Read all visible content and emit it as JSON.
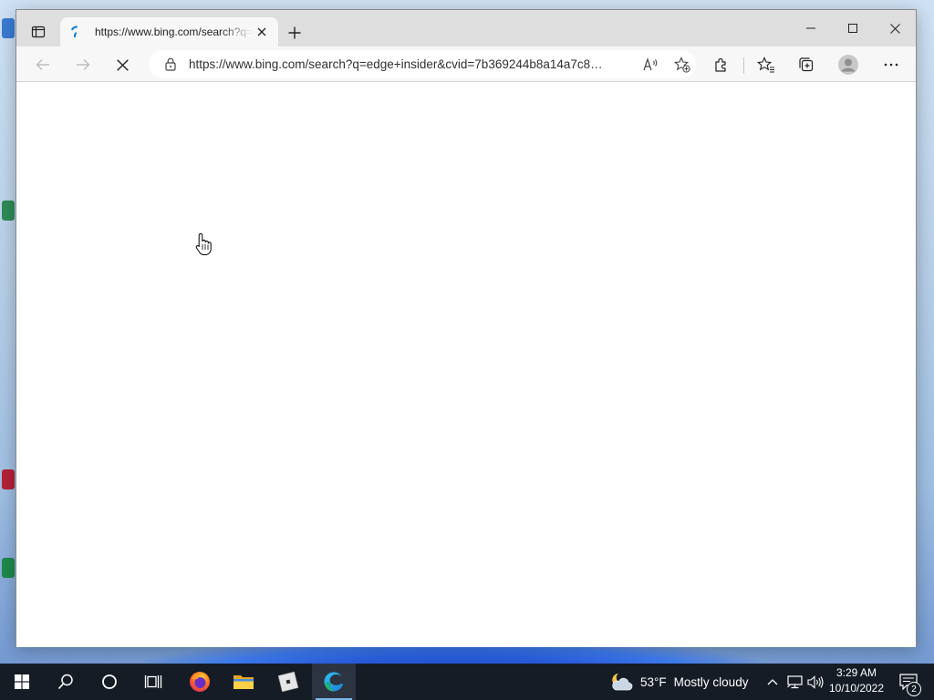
{
  "browser": {
    "tab": {
      "title": "https://www.bing.com/search?q=edge+insider",
      "close_icon": "close-icon",
      "favicon": "loading-spinner-icon"
    },
    "new_tab_icon": "plus-icon",
    "window_controls": [
      "minimize-icon",
      "maximize-icon",
      "close-icon"
    ],
    "toolbar": {
      "url": "https://www.bing.com/search?q=edge+insider&cvid=7b369244b8a14a7c8…",
      "back_icon": "arrow-left-icon",
      "forward_icon": "arrow-right-icon",
      "stop_icon": "stop-loading-icon",
      "read_aloud_icon": "read-aloud-icon",
      "add_favorite_icon": "star-add-icon",
      "extensions_icon": "puzzle-icon",
      "favorites_icon": "favorites-icon",
      "collections_icon": "collections-icon",
      "profile_icon": "profile-icon",
      "more_icon": "ellipsis-icon"
    }
  },
  "taskbar": {
    "apps": [
      "windows-start-icon",
      "search-icon",
      "cortana-icon",
      "task-view-icon",
      "firefox-icon",
      "file-explorer-icon",
      "roblox-icon",
      "edge-icon"
    ],
    "weather": {
      "icon": "partly-cloudy-night-icon",
      "temperature": "53°F",
      "condition": "Mostly cloudy"
    },
    "tray_icons": [
      "chevron-up-icon",
      "network-icon",
      "volume-icon"
    ],
    "clock": {
      "time": "3:29 AM",
      "date": "10/10/2022"
    },
    "notifications": {
      "count": "2"
    }
  },
  "colors": {
    "taskbar": "#161c26",
    "accent": "#0078d4",
    "tabstrip": "#dedede",
    "toolbar": "#f7f7f7"
  }
}
